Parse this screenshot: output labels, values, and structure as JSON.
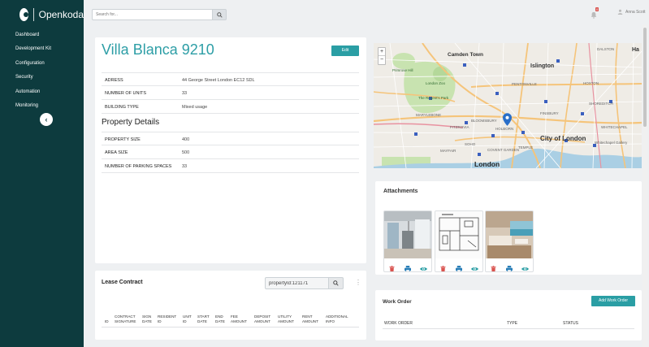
{
  "app": {
    "name": "Openkoda"
  },
  "sidebar": {
    "items": [
      {
        "label": "Dashboard"
      },
      {
        "label": "Development Kit"
      },
      {
        "label": "Configuration"
      },
      {
        "label": "Security"
      },
      {
        "label": "Automation"
      },
      {
        "label": "Monitoring"
      }
    ],
    "collapse_glyph": "‹"
  },
  "topbar": {
    "search_placeholder": "Search for...",
    "notification_count": "0",
    "user_name": "Anna Scott"
  },
  "property": {
    "title": "Villa Blanca 9210",
    "edit_label": "Edit",
    "fields": [
      {
        "label": "ADRESS",
        "value": "44 George Street London EC12 SDL"
      },
      {
        "label": "NUMBER OF UNITS",
        "value": "33"
      },
      {
        "label": "BUILDING TYPE",
        "value": "Mixed usage"
      }
    ],
    "details_title": "Property Details",
    "details": [
      {
        "label": "PROPERTY SIZE",
        "value": "400"
      },
      {
        "label": "AREA SIZE",
        "value": "500"
      },
      {
        "label": "NUMBER OF PARKING SPACES",
        "value": "33"
      }
    ]
  },
  "map": {
    "zoom_in": "+",
    "zoom_out": "−",
    "labels": [
      {
        "text": "Camden Town",
        "kind": "major"
      },
      {
        "text": "Islington",
        "kind": "major"
      },
      {
        "text": "City of London",
        "kind": "major"
      },
      {
        "text": "London",
        "kind": "major"
      },
      {
        "text": "DALSTON",
        "kind": "minor"
      },
      {
        "text": "HOXTON",
        "kind": "minor"
      },
      {
        "text": "PENTONVILLE",
        "kind": "minor"
      },
      {
        "text": "SHOREDITCH",
        "kind": "minor"
      },
      {
        "text": "MARYLEBONE",
        "kind": "minor"
      },
      {
        "text": "FITZROVIA",
        "kind": "minor"
      },
      {
        "text": "BLOOMSBURY",
        "kind": "minor"
      },
      {
        "text": "HOLBORN",
        "kind": "minor"
      },
      {
        "text": "FINSBURY",
        "kind": "minor"
      },
      {
        "text": "WHITECHAPEL",
        "kind": "minor"
      },
      {
        "text": "SOHO",
        "kind": "minor"
      },
      {
        "text": "COVENT GARDEN",
        "kind": "minor"
      },
      {
        "text": "MAYFAIR",
        "kind": "minor"
      },
      {
        "text": "TEMPLE",
        "kind": "minor"
      },
      {
        "text": "The Regent's Park",
        "kind": "park"
      },
      {
        "text": "London Zoo",
        "kind": "park"
      },
      {
        "text": "Primrose Hill",
        "kind": "park"
      },
      {
        "text": "Whitechapel Gallery",
        "kind": "minor"
      },
      {
        "text": "Ha",
        "kind": "major"
      }
    ]
  },
  "attachments": {
    "title": "Attachments",
    "items": [
      {
        "kind": "interior"
      },
      {
        "kind": "floorplan"
      },
      {
        "kind": "living-room"
      }
    ]
  },
  "lease": {
    "title": "Lease Contract",
    "search_value": "propertyId:121171",
    "columns": [
      "ID",
      "CONTRACT SIGNATURE",
      "SIGN DATE",
      "RESIDENT ID",
      "UNIT ID",
      "START DATE",
      "END DATE",
      "FEE AMOUNT",
      "DEPOSIT AMOUNT",
      "UTILITY AMOUNT",
      "RENT AMOUNT",
      "ADDITIONAL INFO"
    ]
  },
  "work_order": {
    "title": "Work Order",
    "add_label": "Add Work Order",
    "columns": [
      "WORK ORDER",
      "TYPE",
      "STATUS"
    ]
  },
  "colors": {
    "sidebar_bg": "#0d3b3e",
    "accent": "#2a9ea4",
    "title": "#2d9ea6",
    "delete": "#d9534f",
    "print": "#2a7fb8",
    "view": "#2a9ea4"
  }
}
